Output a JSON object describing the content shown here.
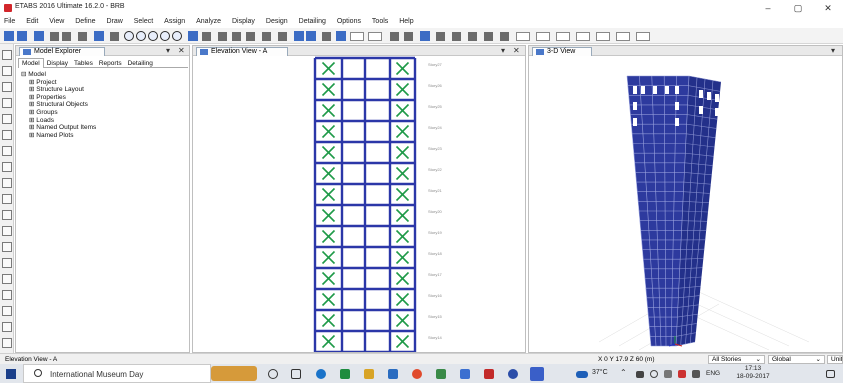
{
  "window": {
    "title": "ETABS 2016 Ultimate 16.2.0 - BRB",
    "minimize": "–",
    "maximize": "▢",
    "close": "✕"
  },
  "menu": [
    "File",
    "Edit",
    "View",
    "Define",
    "Draw",
    "Select",
    "Assign",
    "Analyze",
    "Display",
    "Design",
    "Detailing",
    "Options",
    "Tools",
    "Help"
  ],
  "model_explorer": {
    "title": "Model Explorer",
    "pin": "▾",
    "close": "✕",
    "tabs": [
      "Model",
      "Display",
      "Tables",
      "Reports",
      "Detailing"
    ],
    "active_tab": "Model",
    "root": "Model",
    "items": [
      "Project",
      "Structure Layout",
      "Properties",
      "Structural Objects",
      "Groups",
      "Loads",
      "Named Output Items",
      "Named Plots"
    ]
  },
  "elevation_view": {
    "tab": "Elevation View - A",
    "pin": "▾",
    "close": "✕",
    "story_labels": [
      "Story27",
      "Story26",
      "Story25",
      "Story24",
      "Story23",
      "Story22",
      "Story21",
      "Story20",
      "Story19",
      "Story18",
      "Story17",
      "Story16",
      "Story15",
      "Story14"
    ]
  },
  "three_d_view": {
    "tab": "3-D View",
    "pin": "▾"
  },
  "status": {
    "left": "Elevation View - A",
    "coords": "X 0  Y 17.9  Z 60 (m)",
    "stories": "All Stories",
    "coord_system": "Global",
    "units": "Units..."
  },
  "taskbar": {
    "search_placeholder": "International Museum Day",
    "temperature": "37°C",
    "language": "ENG",
    "time": "17:13",
    "date": "18-09-2017"
  },
  "colors": {
    "frame_blue": "#2b37a8",
    "brace_green": "#1f9a48",
    "building_blue": "#2d3a9e",
    "accent": "#3c6cc4"
  }
}
